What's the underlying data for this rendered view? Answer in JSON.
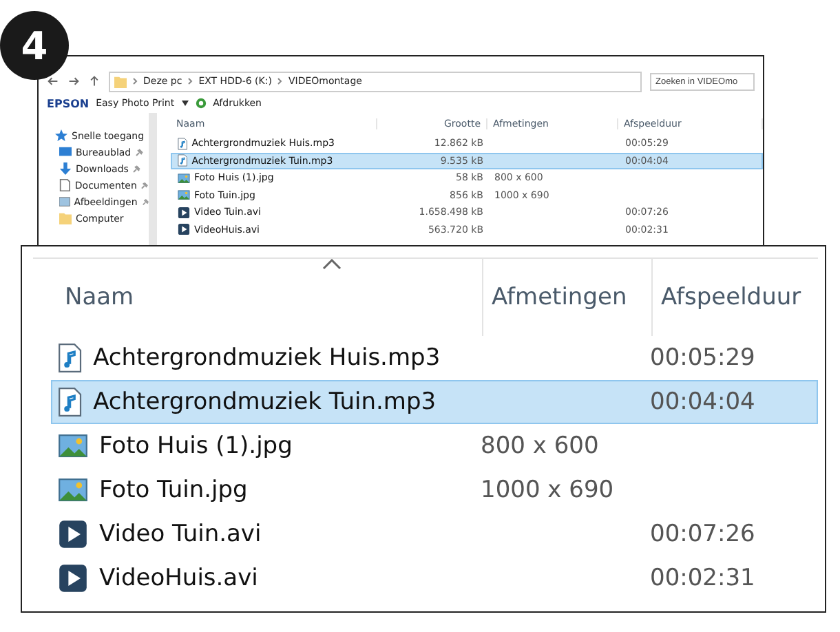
{
  "step_badge": "4",
  "explorer": {
    "breadcrumbs": [
      "Deze pc",
      "EXT HDD-6 (K:)",
      "VIDEOmontage"
    ],
    "search": {
      "placeholder": "Zoeken in VIDEOmo"
    },
    "toolbar": {
      "brand": "EPSON",
      "app": "Easy Photo Print",
      "action": "Afdrukken"
    },
    "sidebar": {
      "items": [
        {
          "label": "Snelle toegang",
          "kind": "star",
          "pinned": false
        },
        {
          "label": "Bureaublad",
          "kind": "desktop",
          "pinned": true
        },
        {
          "label": "Downloads",
          "kind": "download",
          "pinned": true
        },
        {
          "label": "Documenten",
          "kind": "document",
          "pinned": true
        },
        {
          "label": "Afbeeldingen",
          "kind": "pictures",
          "pinned": true
        },
        {
          "label": "Computer",
          "kind": "folder",
          "pinned": false
        }
      ]
    },
    "columns": [
      "Naam",
      "Grootte",
      "Afmetingen",
      "Afspeelduur"
    ],
    "rows": [
      {
        "kind": "audio",
        "name": "Achtergrondmuziek Huis.mp3",
        "size": "12.862 kB",
        "dimensions": "",
        "duration": "00:05:29",
        "selected": false
      },
      {
        "kind": "audio",
        "name": "Achtergrondmuziek Tuin.mp3",
        "size": "9.535 kB",
        "dimensions": "",
        "duration": "00:04:04",
        "selected": true
      },
      {
        "kind": "image",
        "name": "Foto Huis (1).jpg",
        "size": "58 kB",
        "dimensions": "800 x 600",
        "duration": "",
        "selected": false
      },
      {
        "kind": "image",
        "name": "Foto Tuin.jpg",
        "size": "856 kB",
        "dimensions": "1000 x 690",
        "duration": "",
        "selected": false
      },
      {
        "kind": "video",
        "name": "Video Tuin.avi",
        "size": "1.658.498 kB",
        "dimensions": "",
        "duration": "00:07:26",
        "selected": false
      },
      {
        "kind": "video",
        "name": "VideoHuis.avi",
        "size": "563.720 kB",
        "dimensions": "",
        "duration": "00:02:31",
        "selected": false
      }
    ]
  },
  "zoom_panel": {
    "columns": [
      "Naam",
      "Afmetingen",
      "Afspeelduur"
    ],
    "rows": [
      {
        "kind": "audio",
        "name": "Achtergrondmuziek Huis.mp3",
        "dimensions": "",
        "duration": "00:05:29",
        "selected": false
      },
      {
        "kind": "audio",
        "name": "Achtergrondmuziek Tuin.mp3",
        "dimensions": "",
        "duration": "00:04:04",
        "selected": true
      },
      {
        "kind": "image",
        "name": "Foto Huis (1).jpg",
        "dimensions": "800 x 600",
        "duration": "",
        "selected": false
      },
      {
        "kind": "image",
        "name": "Foto Tuin.jpg",
        "dimensions": "1000 x 690",
        "duration": "",
        "selected": false
      },
      {
        "kind": "video",
        "name": "Video Tuin.avi",
        "dimensions": "",
        "duration": "00:07:26",
        "selected": false
      },
      {
        "kind": "video",
        "name": "VideoHuis.avi",
        "dimensions": "",
        "duration": "00:02:31",
        "selected": false
      }
    ]
  }
}
